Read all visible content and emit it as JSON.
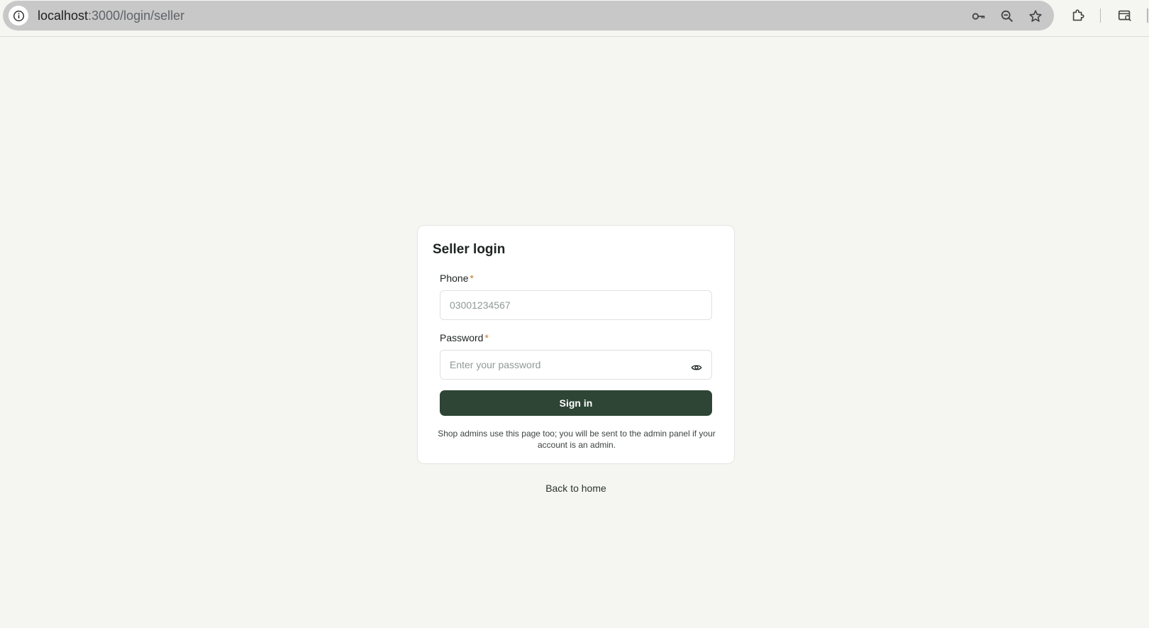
{
  "browser": {
    "url_host": "localhost",
    "url_path": ":3000/login/seller",
    "icons": [
      "info-icon",
      "key-icon",
      "zoom-out-icon",
      "star-icon",
      "extensions-icon",
      "search-tab-icon"
    ]
  },
  "login": {
    "title": "Seller login",
    "phone_label": "Phone",
    "phone_placeholder": "03001234567",
    "password_label": "Password",
    "password_placeholder": "Enter your password",
    "required_marker": "*",
    "submit_label": "Sign in",
    "note": "Shop admins use this page too; you will be sent to the admin panel if your account is an admin."
  },
  "footer": {
    "back_link": "Back to home"
  },
  "colors": {
    "page_bg": "#f5f6f2",
    "button_bg": "#2e4535",
    "required": "#c27a2a"
  }
}
